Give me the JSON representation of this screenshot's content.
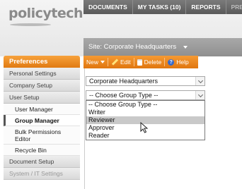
{
  "header": {
    "logo": "policytech",
    "topnav": [
      "DOCUMENTS",
      "MY TASKS (10)",
      "REPORTS",
      "PREF"
    ],
    "site_label": "Site: Corporate Headquarters"
  },
  "sidebar": {
    "header": "Preferences",
    "items": [
      {
        "label": "Personal Settings",
        "kind": "section"
      },
      {
        "label": "Company Setup",
        "kind": "section"
      },
      {
        "label": "User Setup",
        "kind": "section"
      },
      {
        "label": "User Manager",
        "kind": "sub"
      },
      {
        "label": "Group Manager",
        "kind": "sub-active"
      },
      {
        "label": "Bulk Permissions",
        "label2": "Editor",
        "kind": "sub-tall"
      },
      {
        "label": "Recycle Bin",
        "kind": "sub"
      },
      {
        "label": "Document Setup",
        "kind": "section"
      },
      {
        "label": "System / IT Settings",
        "kind": "section-faded"
      }
    ]
  },
  "toolbar": {
    "new_label": "New",
    "edit_label": "Edit",
    "delete_label": "Delete",
    "help_label": "Help"
  },
  "form": {
    "site_select_value": "Corporate Headquarters",
    "group_type_select_value": "-- Choose Group Type --",
    "group_type_options": [
      {
        "label": "-- Choose Group Type --",
        "highlighted": false
      },
      {
        "label": "Writer",
        "highlighted": false
      },
      {
        "label": "Reviewer",
        "highlighted": true
      },
      {
        "label": "Approver",
        "highlighted": false
      },
      {
        "label": "Reader",
        "highlighted": false
      }
    ]
  },
  "colors": {
    "accent_orange": "#e88a1f",
    "nav_gray": "#6a6a6a"
  }
}
